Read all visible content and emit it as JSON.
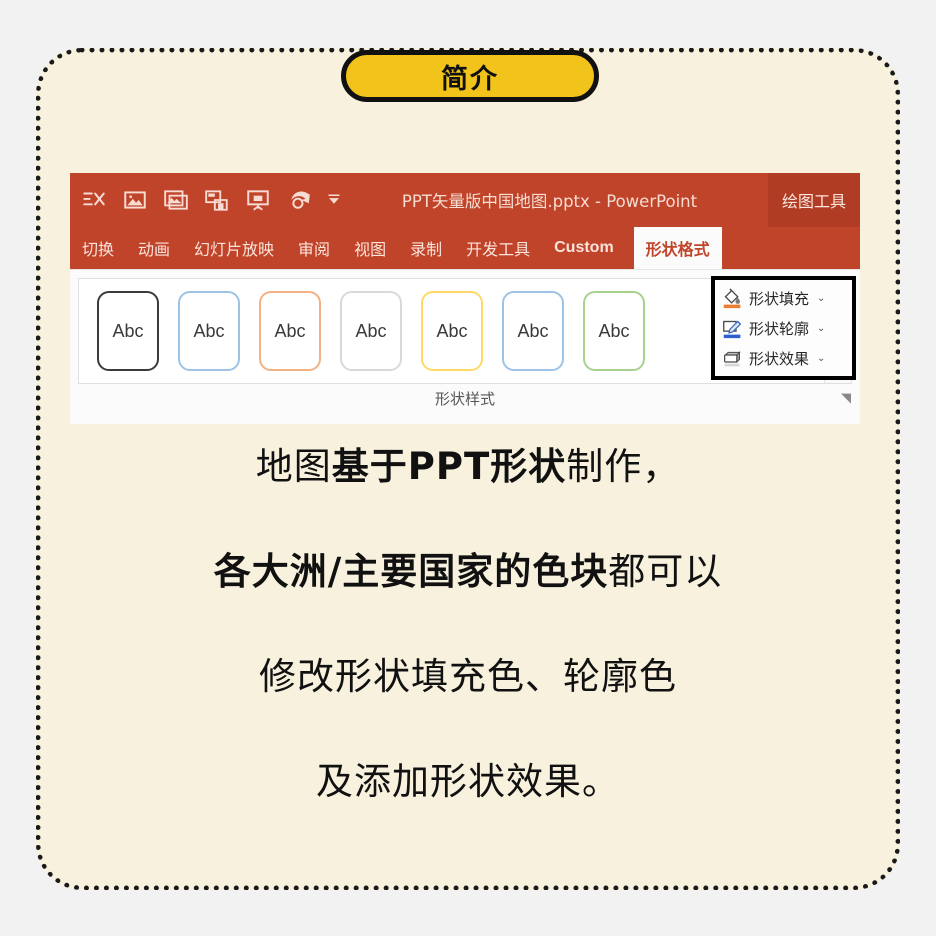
{
  "badge": {
    "label": "简介"
  },
  "powerpoint": {
    "quick_access": [
      {
        "name": "text-box-icon",
        "glyph": "≡✕"
      },
      {
        "name": "picture-icon",
        "glyph": "🖼"
      },
      {
        "name": "picture-frame-icon",
        "glyph": "🖼"
      },
      {
        "name": "save-as-icon",
        "glyph": "💾"
      },
      {
        "name": "slide-show-icon",
        "glyph": "⧉"
      },
      {
        "name": "undo-icon",
        "glyph": "↩"
      },
      {
        "name": "customize-qat-icon",
        "glyph": "▾"
      }
    ],
    "title": "PPT矢量版中国地图.pptx  -  PowerPoint",
    "context_tab": "绘图工具",
    "tabs": [
      {
        "label": "切换",
        "active": false,
        "latin": false
      },
      {
        "label": "动画",
        "active": false,
        "latin": false
      },
      {
        "label": "幻灯片放映",
        "active": false,
        "latin": false
      },
      {
        "label": "审阅",
        "active": false,
        "latin": false
      },
      {
        "label": "视图",
        "active": false,
        "latin": false
      },
      {
        "label": "录制",
        "active": false,
        "latin": false
      },
      {
        "label": "开发工具",
        "active": false,
        "latin": false
      },
      {
        "label": "Custom",
        "active": false,
        "latin": true
      },
      {
        "label": "形状格式",
        "active": true,
        "latin": false
      }
    ],
    "shape_styles": {
      "group_label": "形状样式",
      "swatch_text": "Abc",
      "swatches": [
        {
          "border": "#3b3b3b"
        },
        {
          "border": "#9dc3e6"
        },
        {
          "border": "#f4b183"
        },
        {
          "border": "#d9d9d9"
        },
        {
          "border": "#ffd966"
        },
        {
          "border": "#9dc3e6"
        },
        {
          "border": "#a9d18e"
        }
      ],
      "scroll_up": "▲",
      "scroll_down": "▼",
      "scroll_more": "▼",
      "dialog_launcher": "◥"
    },
    "callout": {
      "items": [
        {
          "icon": "paint-bucket-icon",
          "label": "形状填充",
          "chevron": "⌄",
          "accent": "#ED7D31"
        },
        {
          "icon": "pencil-outline-icon",
          "label": "形状轮廓",
          "chevron": "⌄",
          "accent": "#2E5FD0"
        },
        {
          "icon": "shape-effects-icon",
          "label": "形状效果",
          "chevron": "⌄",
          "accent": "#595959"
        }
      ]
    }
  },
  "body_lines": [
    {
      "segments": [
        {
          "text": "地图",
          "bold": false
        },
        {
          "text": "基于PPT形状",
          "bold": true
        },
        {
          "text": "制作，",
          "bold": false
        }
      ]
    },
    {
      "segments": [
        {
          "text": "各大洲/主要国家的色块",
          "bold": true
        },
        {
          "text": "都可以",
          "bold": false
        }
      ]
    },
    {
      "segments": [
        {
          "text": "修改形状填充色、轮廓色",
          "bold": false
        }
      ]
    },
    {
      "segments": [
        {
          "text": "及添加形状效果。",
          "bold": false
        }
      ]
    }
  ],
  "colors": {
    "page_background": "#f2f2f2",
    "card_background": "#f7f1de",
    "card_border": "#1a1a1a",
    "badge_fill": "#f2c31a",
    "ribbon_orange": "#c0442a",
    "context_tab_orange": "#b03c24",
    "active_tab_text": "#c0442a"
  }
}
